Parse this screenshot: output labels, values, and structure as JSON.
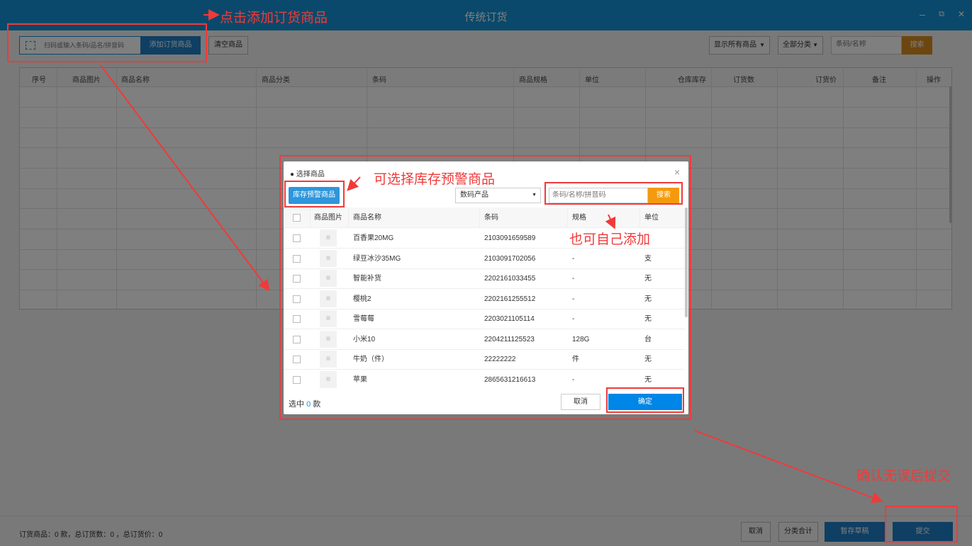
{
  "window": {
    "title": "传统订货",
    "minimize": "–",
    "restore": "⧉",
    "close": "✕"
  },
  "toolbar": {
    "scan_placeholder": "扫码或输入条码/品名/拼音码",
    "add_button": "添加订货商品",
    "clear_button": "清空商品",
    "filter_select": "显示所有商品",
    "category_select": "全部分类",
    "search_placeholder": "条码/名称",
    "search_button": "搜索"
  },
  "main_table": {
    "columns": [
      "序号",
      "商品图片",
      "商品名称",
      "商品分类",
      "条码",
      "商品规格",
      "单位",
      "仓库库存",
      "订货数",
      "订货价",
      "备注",
      "操作"
    ]
  },
  "footer": {
    "summary": "订货商品：0 款，总订货数：0 ，总订货价：0",
    "cancel": "取消",
    "category_total": "分类合计",
    "save_draft": "暂存草稿",
    "submit": "提交"
  },
  "modal": {
    "title": "● 选择商品",
    "close": "×",
    "stock_warning_button": "库存预警商品",
    "category_value": "数码产品",
    "search_placeholder": "条码/名称/拼音码",
    "search_button": "搜索",
    "columns": [
      "商品图片",
      "商品名称",
      "条码",
      "规格",
      "单位"
    ],
    "rows": [
      {
        "name": "百香果20MG",
        "barcode": "2103091659589",
        "spec": "",
        "unit": ""
      },
      {
        "name": "绿豆冰沙35MG",
        "barcode": "2103091702056",
        "spec": "-",
        "unit": "支"
      },
      {
        "name": "智能补货",
        "barcode": "2202161033455",
        "spec": "-",
        "unit": "无"
      },
      {
        "name": "樱桃2",
        "barcode": "2202161255512",
        "spec": "-",
        "unit": "无"
      },
      {
        "name": "雪莓莓",
        "barcode": "2203021105114",
        "spec": "-",
        "unit": "无"
      },
      {
        "name": "小米10",
        "barcode": "2204211125523",
        "spec": "128G",
        "unit": "台"
      },
      {
        "name": "牛奶（件）",
        "barcode": "22222222",
        "spec": "件",
        "unit": "无"
      },
      {
        "name": "苹果",
        "barcode": "2865631216613",
        "spec": "-",
        "unit": "无"
      }
    ],
    "selected_prefix": "选中",
    "selected_count": "0",
    "selected_suffix": "款",
    "cancel": "取消",
    "confirm": "确定"
  },
  "annotations": {
    "add_hint": "点击添加订货商品",
    "warning_hint": "可选择库存预警商品",
    "self_add_hint": "也可自己添加",
    "submit_hint": "确认无误后提交",
    "color": "#f03a3a"
  },
  "colors": {
    "titlebar": "#1593d6",
    "primary": "#1e7fc6",
    "search": "#d98c1e",
    "modal_search": "#f59a0c"
  }
}
